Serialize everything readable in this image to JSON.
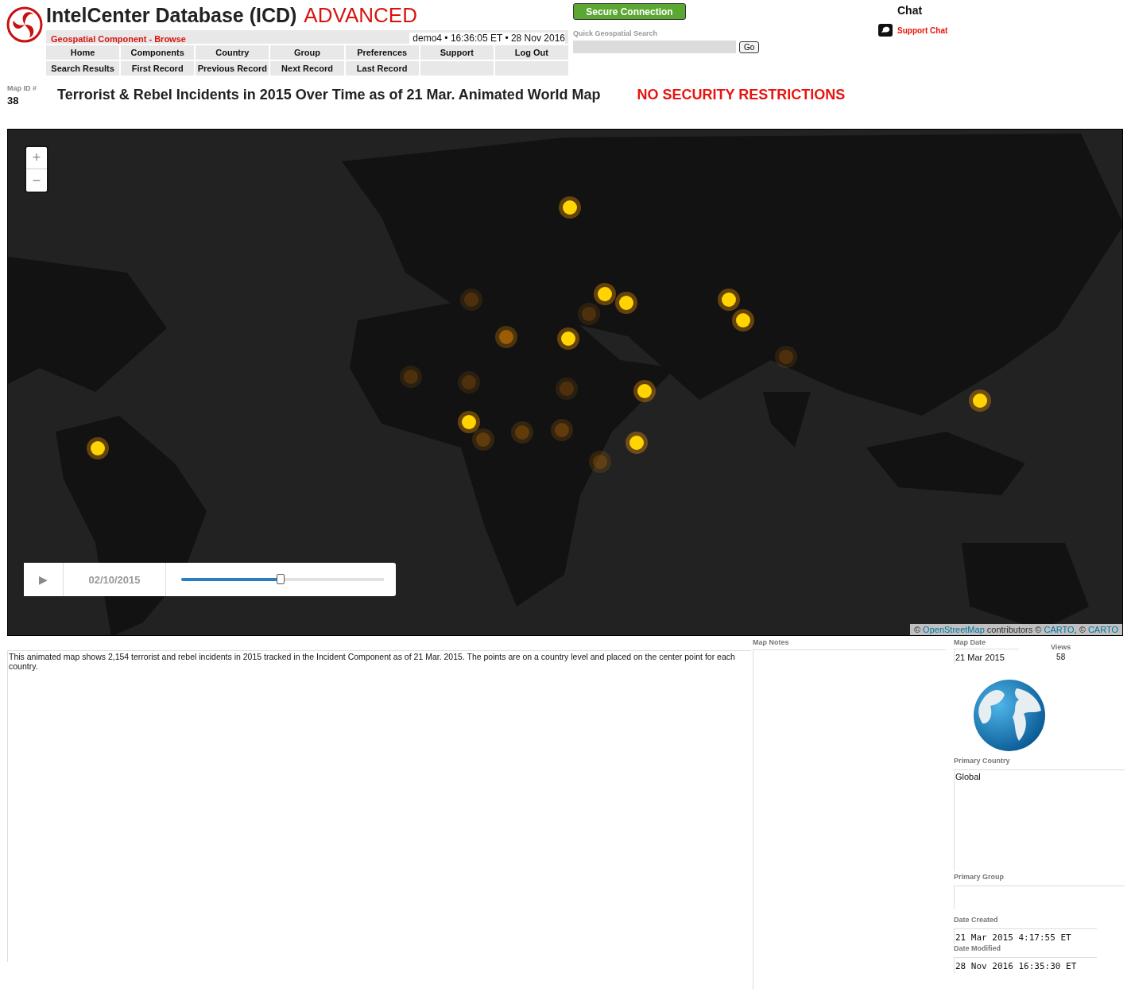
{
  "header": {
    "title": "IntelCenter Database (ICD)",
    "edition": "ADVANCED",
    "section": "Geospatial Component - Browse",
    "session": "demo4 • 16:36:05 ET • 28 Nov 2016"
  },
  "nav_rows": [
    [
      "Home",
      "Components",
      "Country",
      "Group",
      "Preferences",
      "Support",
      "Log Out"
    ],
    [
      "Search Results",
      "First Record",
      "Previous Record",
      "Next Record",
      "Last Record"
    ]
  ],
  "secure_badge": "Secure Connection",
  "quick_search": {
    "label": "Quick Geospatial Search",
    "button": "Go"
  },
  "chat": {
    "title": "Chat",
    "link": "Support Chat"
  },
  "map_id": {
    "label": "Map ID #",
    "value": "38"
  },
  "map_title": "Terrorist & Rebel Incidents in 2015 Over Time as of 21 Mar. Animated World Map",
  "restriction": "NO SECURITY RESTRICTIONS",
  "map": {
    "zoom_in": "+",
    "zoom_out": "−",
    "player": {
      "play": "▶",
      "date": "02/10/2015",
      "level": 0.49
    },
    "attribution": [
      {
        "kind": "text",
        "text": "© "
      },
      {
        "kind": "link",
        "text": "OpenStreetMap"
      },
      {
        "kind": "text",
        "text": " contributors © "
      },
      {
        "kind": "link",
        "text": "CARTO"
      },
      {
        "kind": "text",
        "text": ", © "
      },
      {
        "kind": "link",
        "text": "CARTO"
      }
    ]
  },
  "description": "This animated map shows 2,154 terrorist and rebel incidents in 2015 tracked in the Incident Component as of 21 Mar. 2015. The points are on a country level and placed on the center point for each country.",
  "notes": {
    "label": "Map Notes"
  },
  "details": {
    "map_date": {
      "label": "Map Date",
      "value": "21 Mar 2015"
    },
    "views": {
      "label": "Views",
      "value": "58"
    },
    "primary_country": {
      "label": "Primary Country",
      "value": "Global"
    },
    "primary_group": {
      "label": "Primary Group"
    },
    "date_created": {
      "label": "Date Created",
      "value": "21 Mar 2015 4:17:55 ET"
    },
    "date_modified": {
      "label": "Date Modified",
      "value": "28 Nov 2016 16:35:30 ET"
    }
  }
}
